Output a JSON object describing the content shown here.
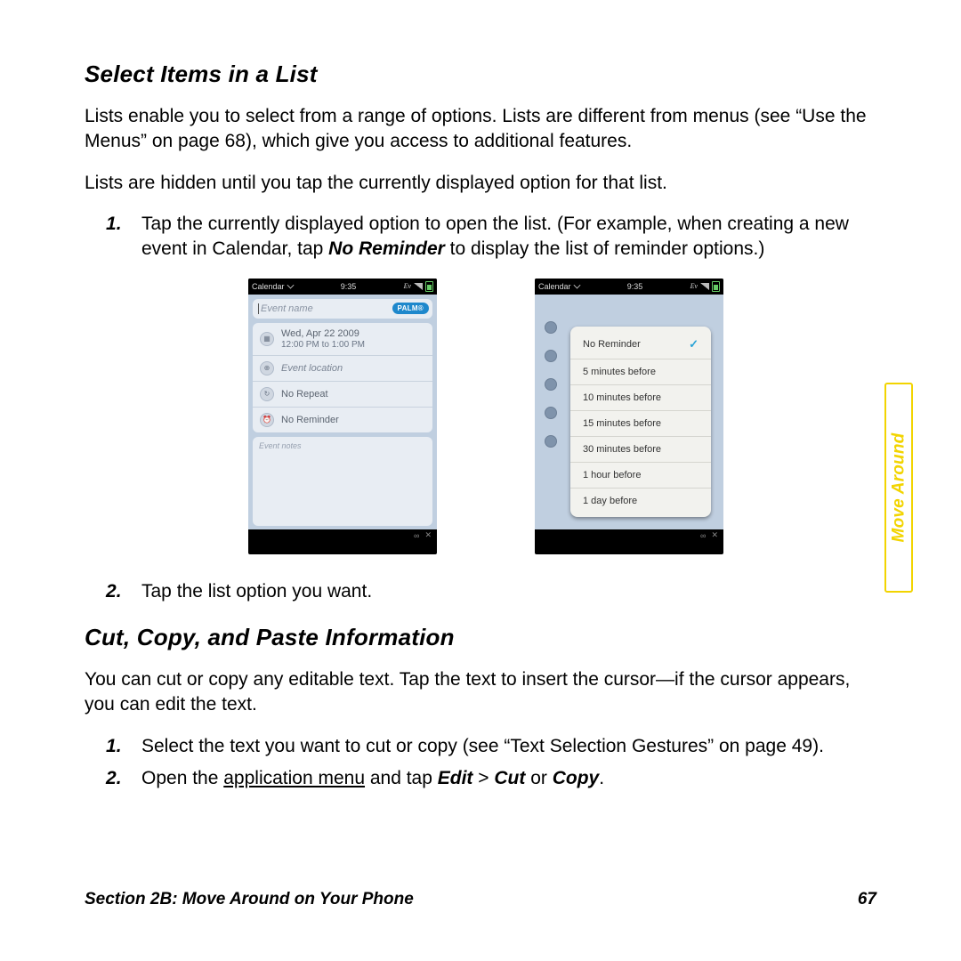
{
  "sections": {
    "select_list": {
      "title": "Select Items in a List",
      "p1": "Lists enable you to select from a range of options. Lists are different from menus (see “Use the Menus” on page 68), which give you access to additional features.",
      "p2": "Lists are hidden until you tap the currently displayed option for that list.",
      "step1_a": "Tap the currently displayed option to open the list. (For example, when creating a new event in Calendar, tap ",
      "step1_bold": "No Reminder",
      "step1_b": " to display the list of reminder options.)",
      "step2": "Tap the list option you want."
    },
    "cut_copy": {
      "title": "Cut, Copy, and Paste Information",
      "p1": "You can cut or copy any editable text. Tap the text to insert the cursor—if the cursor appears, you can edit the text.",
      "step1": "Select the text you want to cut or copy (see “Text Selection Gestures” on page 49).",
      "step2_a": "Open the ",
      "step2_u": "application menu",
      "step2_b": " and tap ",
      "step2_edit": "Edit",
      "step2_gt": " > ",
      "step2_cut": "Cut",
      "step2_or": " or ",
      "step2_copy": "Copy",
      "step2_end": "."
    }
  },
  "phone": {
    "statusbar": {
      "app": "Calendar",
      "time": "9:35",
      "ev": "Ev"
    },
    "left": {
      "event_name_placeholder": "Event name",
      "badge": "PALM®",
      "date_line1": "Wed, Apr 22 2009",
      "date_line2": "12:00 PM to 1:00 PM",
      "location_placeholder": "Event location",
      "repeat": "No Repeat",
      "reminder": "No Reminder",
      "notes_placeholder": "Event notes"
    },
    "right": {
      "options": [
        "No Reminder",
        "5 minutes before",
        "10 minutes before",
        "15 minutes before",
        "30 minutes before",
        "1 hour before",
        "1 day before"
      ],
      "selected_index": 0
    },
    "lip_glyph": "∞"
  },
  "side_tab": "Move Around",
  "footer": {
    "section": "Section 2B: Move Around on Your Phone",
    "page": "67"
  }
}
